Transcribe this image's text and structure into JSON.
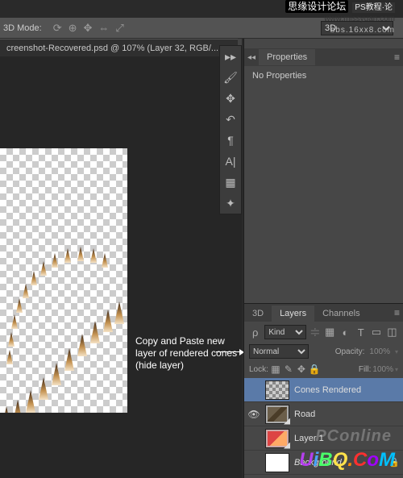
{
  "overlay": {
    "site_cn": "思缘设计论坛",
    "site_url": "www.missyuan.com",
    "tutorial_badge": "PS教程·论",
    "bbs": "bbs.16xx8.com"
  },
  "mode_bar": {
    "label": "3D Mode:",
    "dropdown": "3D"
  },
  "doc_tab": {
    "title": "creenshot-Recovered.psd @ 107% (Layer 32, RGB/...",
    "close": "×"
  },
  "annotation": {
    "text": "Copy and Paste new layer of rendered cones (hide layer)"
  },
  "properties_panel": {
    "tab": "Properties",
    "body": "No Properties"
  },
  "layers_panel": {
    "tabs": [
      "3D",
      "Layers",
      "Channels"
    ],
    "filter_kind": "Kind",
    "filter_sep": "≑",
    "blend_mode": "Normal",
    "opacity_label": "Opacity:",
    "opacity_value": "100%",
    "lock_label": "Lock:",
    "fill_label": "Fill:",
    "fill_value": "100%",
    "layers": [
      {
        "name": "Cones Rendered",
        "visible": false,
        "thumb": "checker",
        "selected": true
      },
      {
        "name": "Road",
        "visible": true,
        "thumb": "road",
        "smart": true
      },
      {
        "name": "Layer 1",
        "visible": false,
        "thumb": "l1",
        "smart": true
      },
      {
        "name": "Background",
        "visible": false,
        "thumb": "bg",
        "locked": true
      }
    ]
  },
  "watermarks": {
    "pc": "PConline",
    "uibq": "UiBQ.CoM"
  },
  "colors": {
    "uibq_u": "#b53fee",
    "uibq_i": "#4aa3ff",
    "uibq_b": "#4aff6a",
    "uibq_q": "#ffe14a",
    "uibq_dot": "#ff8a00",
    "uibq_c": "#ff3030",
    "uibq_o": "#a000ff",
    "uibq_m": "#00c0ff"
  }
}
